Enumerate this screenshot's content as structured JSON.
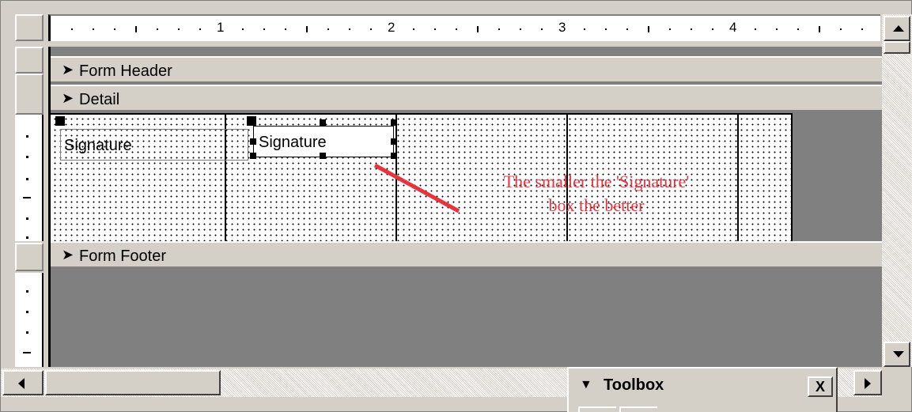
{
  "ruler": {
    "numbers": [
      "1",
      "2",
      "3",
      "4"
    ]
  },
  "sections": {
    "form_header": "Form Header",
    "detail": "Detail",
    "form_footer": "Form Footer"
  },
  "controls": {
    "label_text": "Signature",
    "field_text": "Signature"
  },
  "annotation": {
    "line1": "The smaller the 'Signature'",
    "line2": "box the better",
    "color": "#e8323c"
  },
  "toolbox": {
    "title": "Toolbox",
    "close_label": "X",
    "collapse_icon": "triangle-down-icon"
  },
  "icons": {
    "section_arrow": "section-arrow-icon",
    "scroll_up": "scroll-up-icon",
    "scroll_down": "scroll-down-icon",
    "scroll_left": "scroll-left-icon",
    "scroll_right": "scroll-right-icon"
  }
}
